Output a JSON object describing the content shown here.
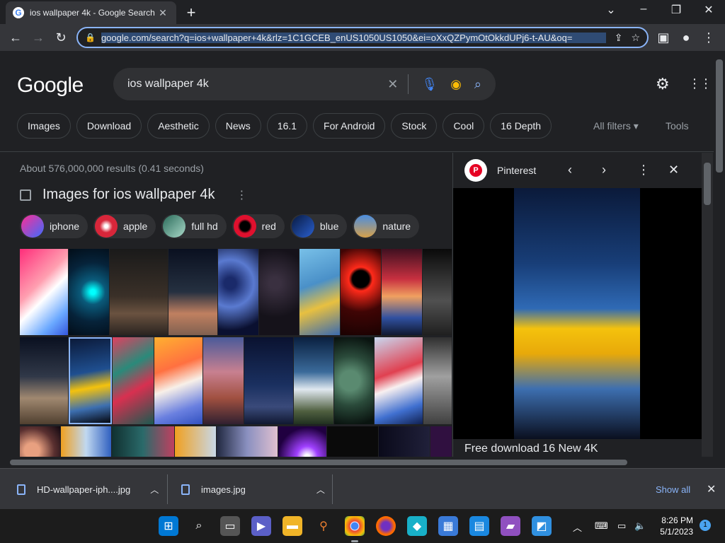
{
  "browser": {
    "tab_title": "ios wallpaper 4k - Google Search",
    "url": "google.com/search?q=ios+wallpaper+4k&rlz=1C1GCEB_enUS1050US1050&ei=oXxQZPymOtOkkdUPj6-t-AU&oq="
  },
  "google": {
    "logo": "Google",
    "query": "ios wallpaper 4k",
    "filter_chips": [
      "Images",
      "Download",
      "Aesthetic",
      "News",
      "16.1",
      "For Android",
      "Stock",
      "Cool",
      "16 Depth"
    ],
    "all_filters": "All filters",
    "tools": "Tools",
    "stats": "About 576,000,000 results (0.41 seconds)",
    "images_heading": "Images for ios wallpaper 4k",
    "sub_chips": [
      {
        "label": "iphone",
        "color": "#e8409a"
      },
      {
        "label": "apple",
        "color": "#d8263a"
      },
      {
        "label": "full hd",
        "color": "#6fb8a0"
      },
      {
        "label": "red",
        "color": "#c8102e"
      },
      {
        "label": "blue",
        "color": "#1d4fa3"
      },
      {
        "label": "nature",
        "color": "#3a7bc8"
      }
    ]
  },
  "side_panel": {
    "source": "Pinterest",
    "caption": "Free download 16 New 4K"
  },
  "downloads": {
    "items": [
      "HD-wallpaper-iph....jpg",
      "images.jpg"
    ],
    "show_all": "Show all"
  },
  "taskbar": {
    "time": "8:26 PM",
    "date": "5/1/2023",
    "notifications": "1"
  }
}
